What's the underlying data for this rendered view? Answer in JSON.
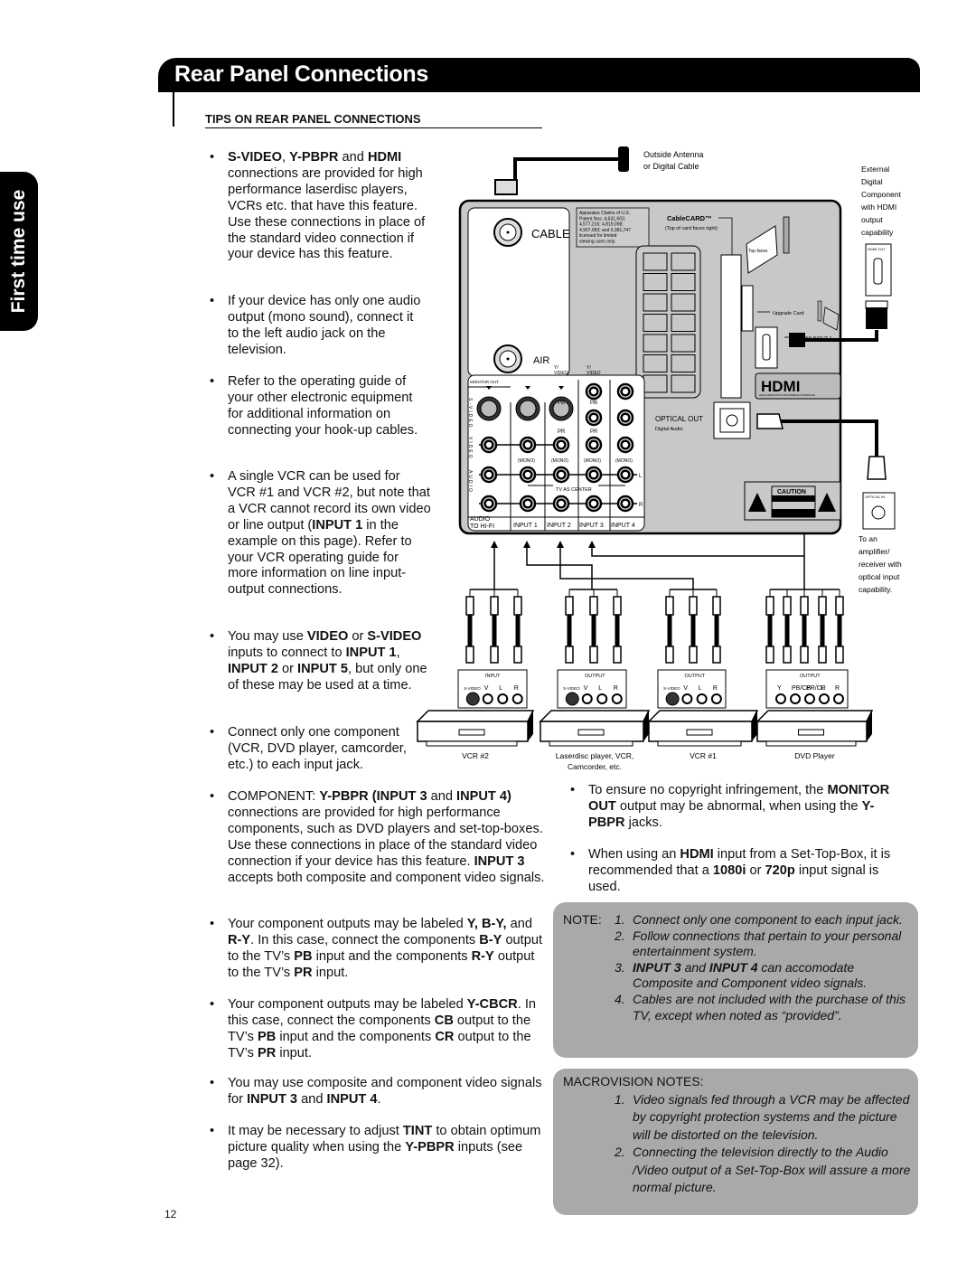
{
  "header": {
    "title": "Rear Panel Connections"
  },
  "side_tab": {
    "label": "First time use"
  },
  "tips_heading": "TIPS ON REAR PANEL CONNECTIONS",
  "left_bullets": [
    [
      {
        "t": "S-VIDEO",
        "b": 1
      },
      {
        "t": ", "
      },
      {
        "t": "Y-PBPR",
        "b": 1
      },
      {
        "t": " and "
      },
      {
        "t": "HDMI",
        "b": 1
      },
      {
        "t": " connections are provided for high performance laserdisc players, VCRs etc. that have this feature. Use these connections in place of the standard video connection if your device has this feature."
      }
    ],
    [
      {
        "t": "If your device has only one audio output (mono sound), connect it to the left audio jack on the television."
      }
    ],
    [
      {
        "t": "Refer to the operating guide of your other electronic equipment for additional information on connecting your hook-up cables."
      }
    ],
    [
      {
        "t": "A single VCR can be used for VCR #1 and VCR #2, but note that a VCR cannot record its own video or line output ("
      },
      {
        "t": "INPUT 1",
        "b": 1
      },
      {
        "t": " in the example on this page). Refer to your VCR operating guide for more information on line input-output connections."
      }
    ],
    [
      {
        "t": "You may use "
      },
      {
        "t": "VIDEO",
        "b": 1
      },
      {
        "t": " or "
      },
      {
        "t": "S-VIDEO",
        "b": 1
      },
      {
        "t": " inputs to connect to "
      },
      {
        "t": "INPUT 1",
        "b": 1
      },
      {
        "t": ", "
      },
      {
        "t": "INPUT 2",
        "b": 1
      },
      {
        "t": " or "
      },
      {
        "t": "INPUT 5",
        "b": 1
      },
      {
        "t": ", but only one of these may be used at a time."
      }
    ],
    [
      {
        "t": "Connect only one component (VCR, DVD player, camcorder, etc.) to each input jack."
      }
    ],
    [
      {
        "t": "COMPONENT: "
      },
      {
        "t": "Y-PBPR",
        "b": 1
      },
      {
        "t": " "
      },
      {
        "t": "(INPUT 3",
        "b": 1
      },
      {
        "t": " and "
      },
      {
        "t": "INPUT 4)",
        "b": 1
      },
      {
        "t": " connections are provided for high performance components, such as DVD players and set-top-boxes. Use these connections in place of the standard video connection if your device has this feature. "
      },
      {
        "t": "INPUT 3",
        "b": 1
      },
      {
        "t": " accepts both composite and component video signals."
      }
    ],
    [
      {
        "t": "Your component outputs may be labeled "
      },
      {
        "t": "Y, B-Y,",
        "b": 1
      },
      {
        "t": " and "
      },
      {
        "t": "R-Y",
        "b": 1
      },
      {
        "t": ". In this case, connect the components "
      },
      {
        "t": "B-Y",
        "b": 1
      },
      {
        "t": " output to the TV’s "
      },
      {
        "t": "PB",
        "b": 1
      },
      {
        "t": " input and the components "
      },
      {
        "t": "R-Y",
        "b": 1
      },
      {
        "t": " output to the TV’s "
      },
      {
        "t": "PR",
        "b": 1
      },
      {
        "t": " input."
      }
    ],
    [
      {
        "t": "Your component outputs may be labeled "
      },
      {
        "t": "Y-CBCR",
        "b": 1
      },
      {
        "t": ". In this case, connect the components "
      },
      {
        "t": "CB",
        "b": 1
      },
      {
        "t": " output to the TV’s "
      },
      {
        "t": "PB",
        "b": 1
      },
      {
        "t": " input and the components "
      },
      {
        "t": "CR",
        "b": 1
      },
      {
        "t": " output to the TV’s "
      },
      {
        "t": "PR",
        "b": 1
      },
      {
        "t": " input."
      }
    ],
    [
      {
        "t": "You may use composite and component video signals for "
      },
      {
        "t": "INPUT 3",
        "b": 1
      },
      {
        "t": " and "
      },
      {
        "t": "INPUT 4",
        "b": 1
      },
      {
        "t": "."
      }
    ],
    [
      {
        "t": "It may be necessary to adjust "
      },
      {
        "t": "TINT",
        "b": 1
      },
      {
        "t": " to obtain optimum picture quality when using the "
      },
      {
        "t": "Y-PBPR",
        "b": 1
      },
      {
        "t": " inputs (see page 32)."
      }
    ]
  ],
  "right_bullets": [
    [
      {
        "t": "To ensure no copyright infringement, the "
      },
      {
        "t": "MONITOR OUT",
        "b": 1
      },
      {
        "t": " output may be abnormal, when using the "
      },
      {
        "t": "Y-PBPR",
        "b": 1
      },
      {
        "t": " jacks."
      }
    ],
    [
      {
        "t": "When using an "
      },
      {
        "t": "HDMI",
        "b": 1
      },
      {
        "t": " input from a Set-Top-Box, it is recommended that a "
      },
      {
        "t": "1080i",
        "b": 1
      },
      {
        "t": " or "
      },
      {
        "t": "720p",
        "b": 1
      },
      {
        "t": " input signal is used."
      }
    ]
  ],
  "note": {
    "heading": "NOTE:",
    "items": [
      [
        {
          "t": "Connect only one component to each input jack."
        }
      ],
      [
        {
          "t": "Follow connections that pertain to your personal entertainment system."
        }
      ],
      [
        {
          "t": "INPUT 3",
          "b": 1
        },
        {
          "t": " and "
        },
        {
          "t": "INPUT 4",
          "b": 1
        },
        {
          "t": " can accomodate Composite and Component video signals."
        }
      ],
      [
        {
          "t": "Cables are not included with the purchase of this TV, except when noted as “provided”."
        }
      ]
    ]
  },
  "macrovision": {
    "heading": "MACROVISION NOTES:",
    "items": [
      [
        {
          "t": "Video signals fed through a VCR may be affected by copyright protection systems and the picture will be distorted on the television."
        }
      ],
      [
        {
          "t": "Connecting the television directly to the Audio /Video output of a Set-Top-Box will assure a more normal picture."
        }
      ]
    ]
  },
  "diagram": {
    "antenna": [
      "Outside Antenna",
      "or Digital Cable"
    ],
    "cable": "CABLE",
    "air": "AIR",
    "patent": [
      "Apparatus Claims of U.S.",
      "Patent Nos. 4,631,603;",
      "4,577,216; 4,819,098;",
      "4,907,093; and 6,381,747",
      "licensed for limited",
      "viewing uses only."
    ],
    "cablecard": "CableCARD™",
    "cablecard_note": "(Top of card faces right)",
    "top_faces": "Top faces",
    "upgrade_card": "Upgrade Card",
    "hdmi_input": "HDMI INPUT 1",
    "hdmi_logo": "HDMI",
    "hdmi_sub": "HIGH-DEFINITION MULTIMEDIA INTERFACE",
    "optical_out": "OPTICAL OUT",
    "digital_audio": "Digital Audio",
    "monitor_out": "MONITOR OUT",
    "svideo_vert": "S-VIDEO",
    "video_vert": "VIDEO",
    "audio_vert": "AUDIO",
    "y_video": [
      "Y/",
      "VIDEO"
    ],
    "pb": "PB",
    "pr": "PR",
    "mono": "(MONO)",
    "tv_as_center": "TV AS CENTER",
    "l": "L",
    "r": "R",
    "audio_hifi": [
      "AUDIO",
      "TO HI-FI"
    ],
    "inputs": [
      "INPUT 1",
      "INPUT 2",
      "INPUT 3",
      "INPUT 4"
    ],
    "caution": "CAUTION",
    "external": [
      "External",
      "Digital",
      "Component",
      "with HDMI",
      "output",
      "capability"
    ],
    "hdmi_out": "HDMI OUT",
    "optical_in": "OPTICAL IN",
    "optical_note": [
      "To an",
      "amplifier/",
      "receiver with",
      "optical input",
      "capability."
    ],
    "devices": [
      {
        "panel": "INPUT",
        "jacks": [
          "S-VIDEO",
          "V",
          "L",
          "R"
        ],
        "name": [
          "VCR #2"
        ]
      },
      {
        "panel": "OUTPUT",
        "jacks": [
          "S-VIDEO",
          "V",
          "L",
          "R"
        ],
        "name": [
          "Laserdisc player, VCR,",
          "Camcorder, etc."
        ]
      },
      {
        "panel": "OUTPUT",
        "jacks": [
          "S-VIDEO",
          "V",
          "L",
          "R"
        ],
        "name": [
          "VCR #1"
        ]
      },
      {
        "panel": "OUTPUT",
        "jacks": [
          "Y",
          "PB/CB",
          "PR/CR",
          "L",
          "R"
        ],
        "name": [
          "DVD Player"
        ]
      }
    ]
  },
  "page_number": "12",
  "colors": {
    "header": "#000000",
    "panel": "#c8c8c8",
    "note_bg": "#a9a9a9"
  }
}
